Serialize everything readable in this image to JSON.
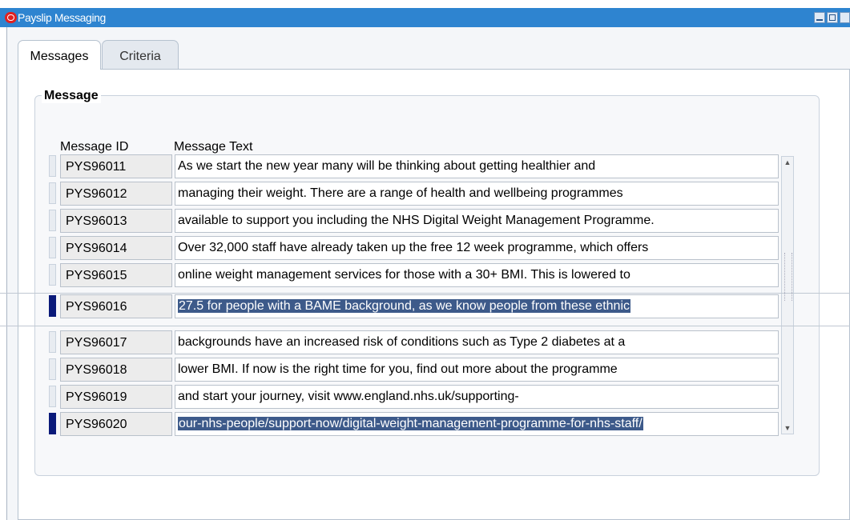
{
  "window": {
    "title": "Payslip Messaging"
  },
  "tabs": [
    {
      "label": "Messages",
      "active": true
    },
    {
      "label": "Criteria",
      "active": false
    }
  ],
  "group": {
    "title": "Message"
  },
  "columns": {
    "id": "Message ID",
    "text": "Message Text"
  },
  "rows": [
    {
      "id": "PYS96011",
      "text": "As we start the new year many will be thinking about getting healthier and",
      "selected": false
    },
    {
      "id": "PYS96012",
      "text": "managing their weight. There are a range of health and wellbeing programmes",
      "selected": false
    },
    {
      "id": "PYS96013",
      "text": "available to support you including the NHS Digital Weight Management Programme.",
      "selected": false
    },
    {
      "id": "PYS96014",
      "text": "Over 32,000 staff have already taken up the free 12 week programme, which offers",
      "selected": false
    },
    {
      "id": "PYS96015",
      "text": "online weight management services for those with a 30+ BMI. This is lowered to",
      "selected": false
    },
    {
      "id": "PYS96016",
      "text": "27.5 for people with a BAME background, as we know people from these ethnic",
      "selected": true
    },
    {
      "id": "PYS96017",
      "text": "backgrounds have an increased risk of conditions such as Type 2 diabetes at a",
      "selected": false
    },
    {
      "id": "PYS96018",
      "text": "lower BMI. If now is the right time for you, find out more about the programme",
      "selected": false
    },
    {
      "id": "PYS96019",
      "text": "and start your journey, visit www.england.nhs.uk/supporting-",
      "selected": false
    },
    {
      "id": "PYS96020",
      "text": "our-nhs-people/support-now/digital-weight-management-programme-for-nhs-staff/",
      "selected": true
    }
  ],
  "colors": {
    "titlebar": "#2e84d0",
    "selection": "#3d5a8a",
    "indicator": "#0a1a7a"
  }
}
